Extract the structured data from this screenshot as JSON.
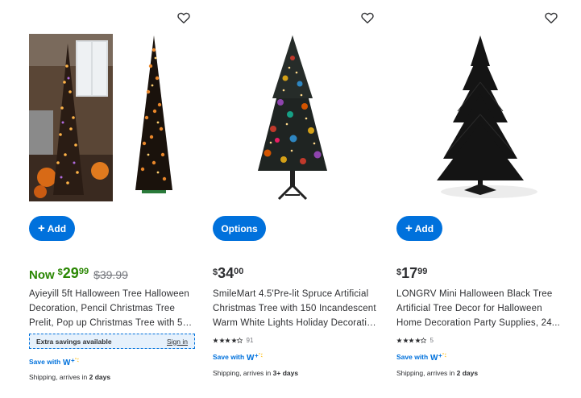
{
  "products": [
    {
      "button_label": "Add",
      "price_prefix": "Now",
      "currency": "$",
      "price_dollars": "29",
      "price_cents": "99",
      "was_price": "$39.99",
      "title_lines": [
        "Ayieyill 5ft Halloween Tree Halloween",
        "Decoration, Pencil Christmas Tree",
        "Prelit, Pop up Christmas Tree with 50..."
      ],
      "savings_label": "Extra savings available",
      "signin_label": "Sign in",
      "save_with": "Save with",
      "shipping_prefix": "Shipping, arrives in ",
      "shipping_days": "2 days"
    },
    {
      "button_label": "Options",
      "currency": "$",
      "price_dollars": "34",
      "price_cents": "00",
      "title_lines": [
        "SmileMart 4.5'Pre-lit Spruce Artificial",
        "Christmas Tree with 150 Incandescent",
        "Warm White Lights Holiday Decorativ..."
      ],
      "rating": 4,
      "review_count": "91",
      "save_with": "Save with",
      "shipping_prefix": "Shipping, arrives in ",
      "shipping_days": "3+ days"
    },
    {
      "button_label": "Add",
      "currency": "$",
      "price_dollars": "17",
      "price_cents": "99",
      "title_lines": [
        "LONGRV Mini Halloween Black Tree",
        "Artificial Tree Decor for Halloween",
        "Home Decoration Party Supplies, 24..."
      ],
      "rating": 4,
      "review_count": "5",
      "save_with": "Save with",
      "shipping_prefix": "Shipping, arrives in ",
      "shipping_days": "2 days"
    }
  ],
  "colors": {
    "brand_blue": "#0071dc",
    "sale_green": "#2a8703",
    "spark_yellow": "#ffc220"
  },
  "icons": [
    "heart-icon",
    "plus-icon",
    "star-icon",
    "walmart-plus-icon"
  ]
}
